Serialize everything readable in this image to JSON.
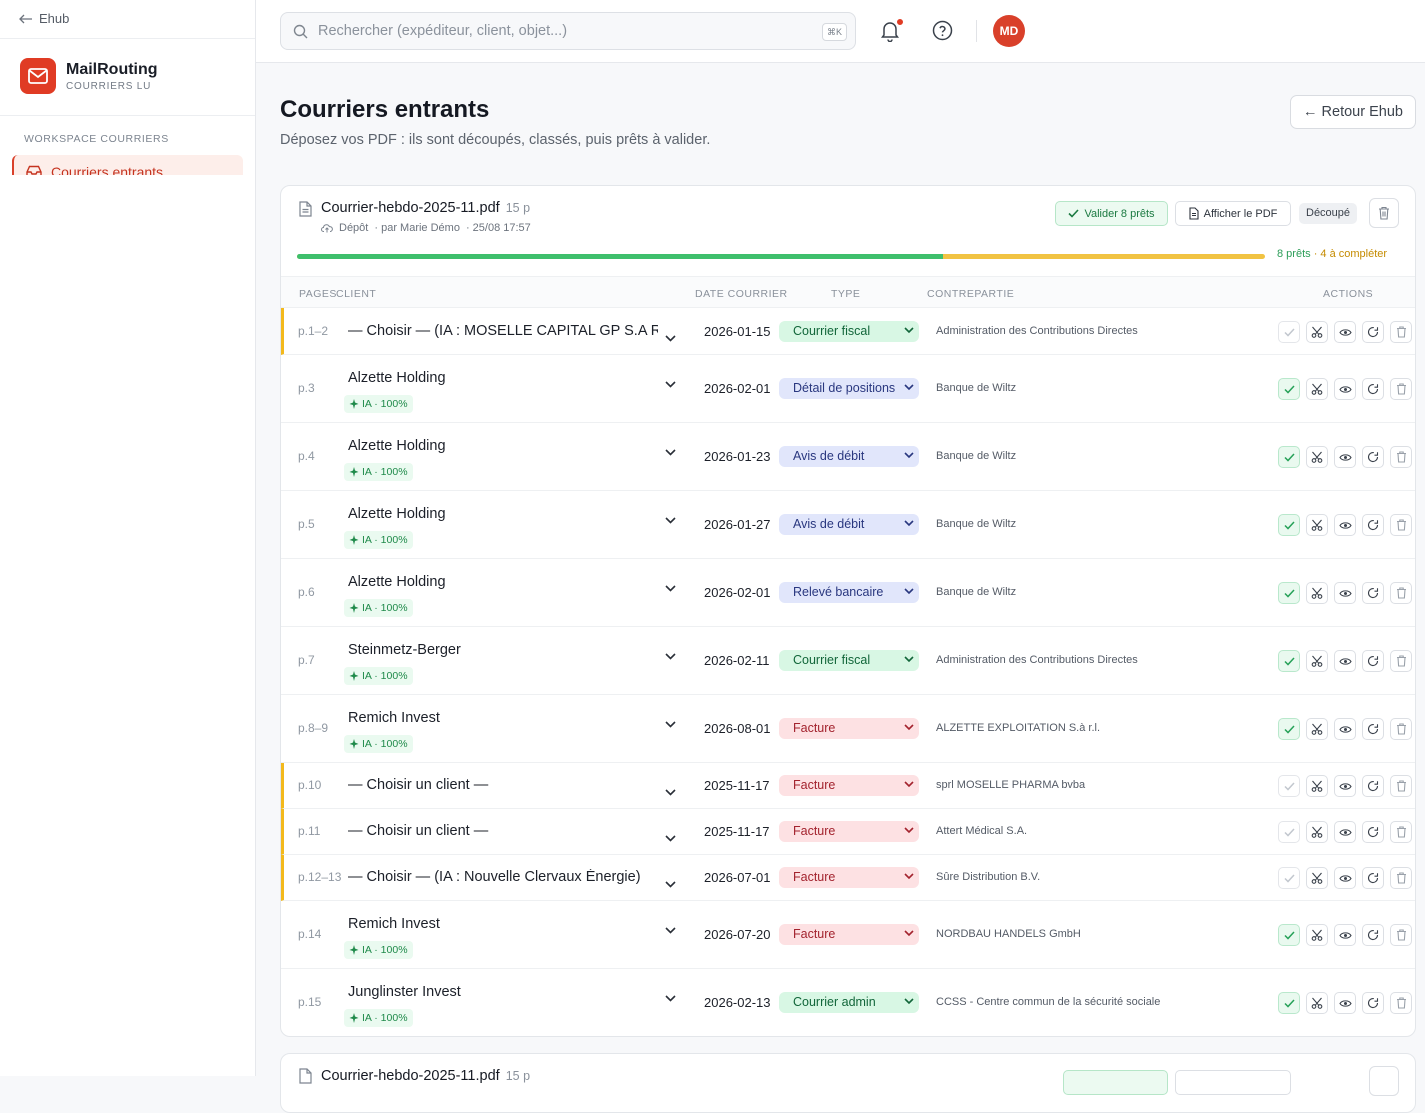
{
  "sidebar": {
    "back_label": "Ehub",
    "brand_name": "MailRouting",
    "brand_sub": "COURRIERS LU",
    "section_label": "WORKSPACE COURRIERS",
    "nav_active": "Courriers entrants"
  },
  "topbar": {
    "search_placeholder": "Rechercher (expéditeur, client, objet...)",
    "search_shortcut": "⌘K",
    "avatar_initials": "MD"
  },
  "page": {
    "title": "Courriers entrants",
    "subtitle": "Déposez vos PDF : ils sont découpés, classés, puis prêts à valider.",
    "back_button": "← Retour Ehub"
  },
  "batch": {
    "filename": "Courrier-hebdo-2025-11.pdf",
    "pages": "15 p",
    "meta_source": "Dépôt",
    "meta_author": "· par Marie Démo",
    "meta_date": "· 25/08 17:57",
    "validate_button": "Valider 8 prêts",
    "pdf_button": "Afficher le PDF",
    "status_badge": "Découpé",
    "progress_ready_fraction": 0.667,
    "ready_text": "8 prêts",
    "todo_text": "· 4 à compléter",
    "colors": {
      "ready": "#3ebf6c",
      "todo": "#f1c343",
      "warn_border": "#f3b91c"
    }
  },
  "table": {
    "headers": {
      "pages": "PAGES",
      "client": "CLIENT",
      "date": "DATE COURRIER",
      "type": "TYPE",
      "counterparty": "CONTREPARTIE",
      "actions": "ACTIONS"
    },
    "rows": [
      {
        "pages": "p.1–2",
        "client": "— Choisir — (IA : MOSELLE CAPITAL GP S.A R.L.)",
        "ia": "",
        "date": "2026-01-15",
        "type": "Courrier fiscal",
        "type_color": "green",
        "counterparty": "Administration des Contributions Directes",
        "ready": false
      },
      {
        "pages": "p.3",
        "client": "Alzette Holding",
        "ia": "IA · 100%",
        "date": "2026-02-01",
        "type": "Détail de positions",
        "type_color": "blue",
        "counterparty": "Banque de Wiltz",
        "ready": true
      },
      {
        "pages": "p.4",
        "client": "Alzette Holding",
        "ia": "IA · 100%",
        "date": "2026-01-23",
        "type": "Avis de débit",
        "type_color": "blue",
        "counterparty": "Banque de Wiltz",
        "ready": true
      },
      {
        "pages": "p.5",
        "client": "Alzette Holding",
        "ia": "IA · 100%",
        "date": "2026-01-27",
        "type": "Avis de débit",
        "type_color": "blue",
        "counterparty": "Banque de Wiltz",
        "ready": true
      },
      {
        "pages": "p.6",
        "client": "Alzette Holding",
        "ia": "IA · 100%",
        "date": "2026-02-01",
        "type": "Relevé bancaire",
        "type_color": "blue",
        "counterparty": "Banque de Wiltz",
        "ready": true
      },
      {
        "pages": "p.7",
        "client": "Steinmetz-Berger",
        "ia": "IA · 100%",
        "date": "2026-02-11",
        "type": "Courrier fiscal",
        "type_color": "green",
        "counterparty": "Administration des Contributions Directes",
        "ready": true
      },
      {
        "pages": "p.8–9",
        "client": "Remich Invest",
        "ia": "IA · 100%",
        "date": "2026-08-01",
        "type": "Facture",
        "type_color": "red",
        "counterparty": "ALZETTE EXPLOITATION S.à r.l.",
        "ready": true
      },
      {
        "pages": "p.10",
        "client": "— Choisir un client —",
        "ia": "",
        "date": "2025-11-17",
        "type": "Facture",
        "type_color": "red",
        "counterparty": "sprl MOSELLE PHARMA bvba",
        "ready": false
      },
      {
        "pages": "p.11",
        "client": "— Choisir un client —",
        "ia": "",
        "date": "2025-11-17",
        "type": "Facture",
        "type_color": "red",
        "counterparty": "Attert Médical S.A.",
        "ready": false
      },
      {
        "pages": "p.12–13",
        "client": "— Choisir — (IA : Nouvelle Clervaux Énergie)",
        "ia": "",
        "date": "2026-07-01",
        "type": "Facture",
        "type_color": "red",
        "counterparty": "Sûre Distribution B.V.",
        "ready": false
      },
      {
        "pages": "p.14",
        "client": "Remich Invest",
        "ia": "IA · 100%",
        "date": "2026-07-20",
        "type": "Facture",
        "type_color": "red",
        "counterparty": "NORDBAU HANDELS GmbH",
        "ready": true
      },
      {
        "pages": "p.15",
        "client": "Junglinster Invest",
        "ia": "IA · 100%",
        "date": "2026-02-13",
        "type": "Courrier admin",
        "type_color": "green",
        "counterparty": "CCSS - Centre commun de la sécurité sociale",
        "ready": true
      }
    ]
  },
  "batch2": {
    "filename": "Courrier-hebdo-2025-11.pdf",
    "pages": "15 p"
  }
}
